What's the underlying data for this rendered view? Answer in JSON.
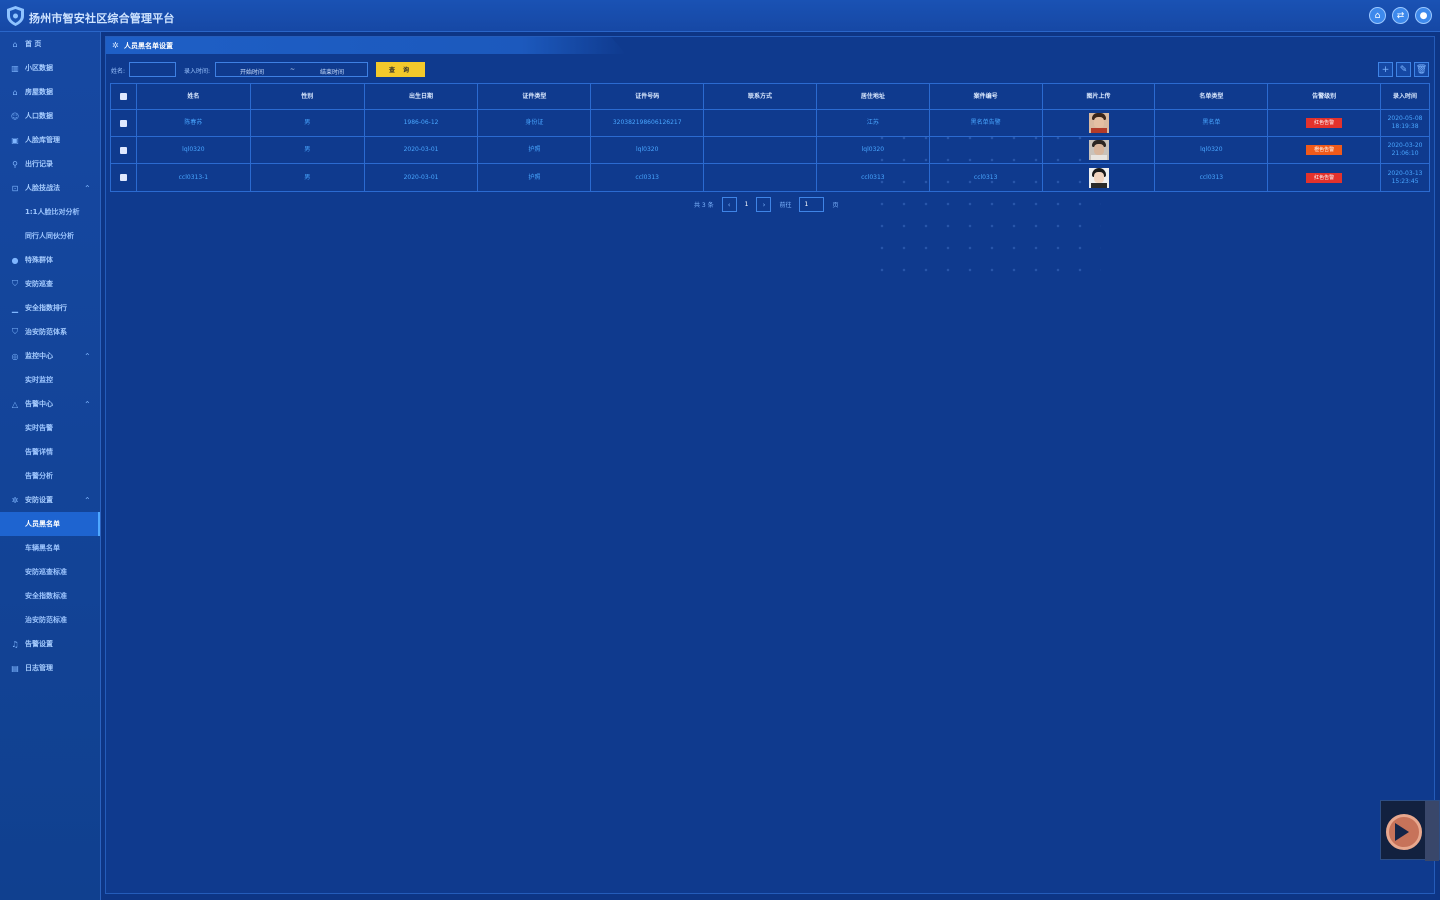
{
  "app": {
    "title": "扬州市智安社区综合管理平台"
  },
  "sidebar": {
    "items": [
      {
        "label": "首 页",
        "icon": "home-icon"
      },
      {
        "label": "小区数据",
        "icon": "building-icon"
      },
      {
        "label": "房屋数据",
        "icon": "house-icon"
      },
      {
        "label": "人口数据",
        "icon": "people-icon"
      },
      {
        "label": "人脸库管理",
        "icon": "face-library-icon"
      },
      {
        "label": "出行记录",
        "icon": "walk-icon"
      },
      {
        "label": "人脸技战法",
        "icon": "face-scan-icon"
      },
      {
        "label": "1:1人脸比对分析",
        "icon": ""
      },
      {
        "label": "同行人同伙分析",
        "icon": ""
      },
      {
        "label": "特殊群体",
        "icon": "user-icon"
      },
      {
        "label": "安防巡查",
        "icon": "shield-icon"
      },
      {
        "label": "安全指数排行",
        "icon": "chart-icon"
      },
      {
        "label": "治安防范体系",
        "icon": "shield-check-icon"
      },
      {
        "label": "监控中心",
        "icon": "camera-icon"
      },
      {
        "label": "实时监控",
        "icon": ""
      },
      {
        "label": "告警中心",
        "icon": "warning-icon"
      },
      {
        "label": "实时告警",
        "icon": ""
      },
      {
        "label": "告警详情",
        "icon": ""
      },
      {
        "label": "告警分析",
        "icon": ""
      },
      {
        "label": "安防设置",
        "icon": "gear-icon"
      },
      {
        "label": "人员黑名单",
        "icon": ""
      },
      {
        "label": "车辆黑名单",
        "icon": ""
      },
      {
        "label": "安防巡查标准",
        "icon": ""
      },
      {
        "label": "安全指数标准",
        "icon": ""
      },
      {
        "label": "治安防范标准",
        "icon": ""
      },
      {
        "label": "告警设置",
        "icon": "bell-icon"
      },
      {
        "label": "日志管理",
        "icon": "log-icon"
      }
    ]
  },
  "page": {
    "tab_title": "人员黑名单设置"
  },
  "filter": {
    "name_label": "姓名:",
    "time_label": "录入时间:",
    "start_placeholder": "开始时间",
    "dash": "~",
    "end_placeholder": "结束时间",
    "query_button": "查 询"
  },
  "table": {
    "headers": [
      "姓名",
      "性别",
      "出生日期",
      "证件类型",
      "证件号码",
      "联系方式",
      "居住地址",
      "案件编号",
      "图片上传",
      "名单类型",
      "告警级别",
      "录入时间"
    ],
    "rows": [
      {
        "name": "陈春苏",
        "gender": "男",
        "birth": "1986-06-12",
        "id_type": "身份证",
        "id_no": "320382198606126217",
        "contact": "",
        "address": "江苏",
        "case_no": "黑名单告警",
        "list_type": "黑名单",
        "alarm": "红色告警",
        "alarm_color": "#e3322c",
        "time1": "2020-05-08",
        "time2": "18:19:38"
      },
      {
        "name": "lql0320",
        "gender": "男",
        "birth": "2020-03-01",
        "id_type": "护照",
        "id_no": "lql0320",
        "contact": "",
        "address": "lql0320",
        "case_no": "",
        "list_type": "lql0320",
        "alarm": "橙色告警",
        "alarm_color": "#f05a1a",
        "time1": "2020-03-20",
        "time2": "21:06:10"
      },
      {
        "name": "ccl0313-1",
        "gender": "男",
        "birth": "2020-03-01",
        "id_type": "护照",
        "id_no": "ccl0313",
        "contact": "",
        "address": "ccl0313",
        "case_no": "ccl0313",
        "list_type": "ccl0313",
        "alarm": "红色告警",
        "alarm_color": "#e3322c",
        "time1": "2020-03-13",
        "time2": "15:23:45"
      }
    ]
  },
  "pagination": {
    "total": "共 3 条",
    "current": "1",
    "goto_label": "前往",
    "goto_value": "1",
    "page_unit": "页"
  }
}
